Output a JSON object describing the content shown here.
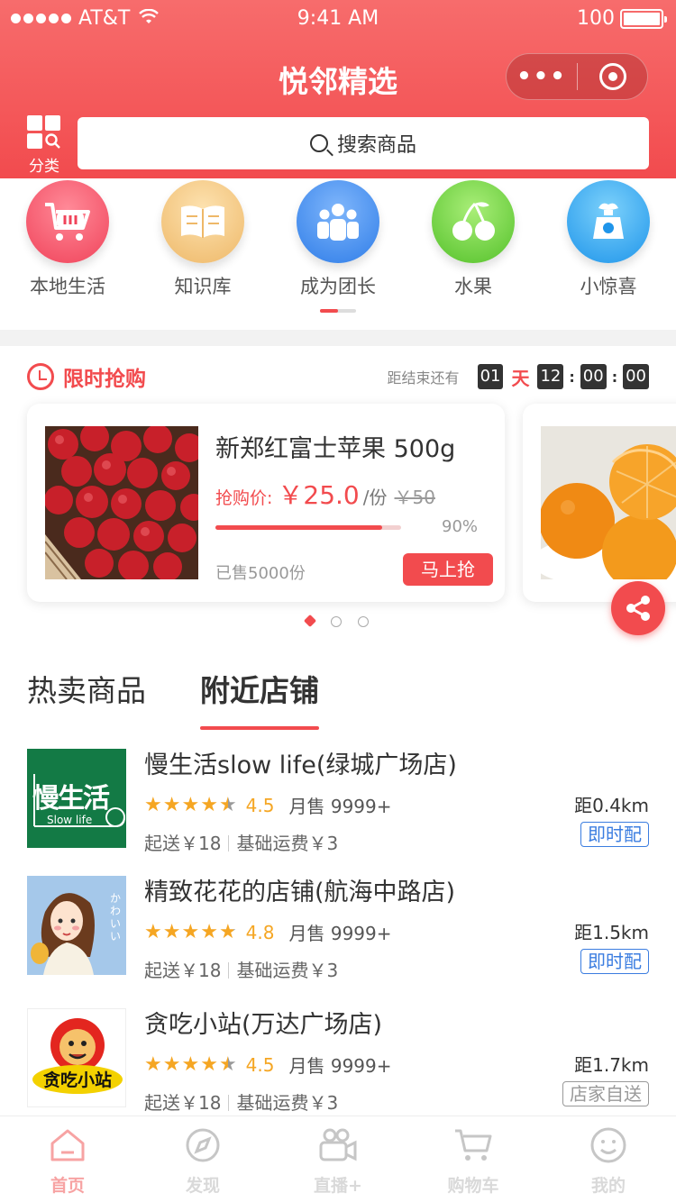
{
  "status_bar": {
    "carrier": "AT&T",
    "time": "9:41 AM",
    "battery": "100"
  },
  "header": {
    "title": "悦邻精选",
    "category_label": "分类",
    "search_placeholder": "搜索商品"
  },
  "categories": [
    {
      "label": "本地生活",
      "icon": "basket-icon",
      "color": "#f2576b"
    },
    {
      "label": "知识库",
      "icon": "book-icon",
      "color": "#f0c478"
    },
    {
      "label": "成为团长",
      "icon": "group-icon",
      "color": "#3f8ef0"
    },
    {
      "label": "水果",
      "icon": "cherry-icon",
      "color": "#6fd33e"
    },
    {
      "label": "小惊喜",
      "icon": "gift-bag-icon",
      "color": "#34a5ef"
    }
  ],
  "flash_sale": {
    "title": "限时抢购",
    "ends_in_label": "距结束还有",
    "days": "01",
    "day_unit": "天",
    "hours": "12",
    "minutes": "00",
    "seconds": "00",
    "product": {
      "name": "新郑红富士苹果 500g",
      "price_label": "抢购价:",
      "price": "￥25.0",
      "unit": "/份",
      "original_price": "￥50",
      "progress": 0.9,
      "progress_text": "90%",
      "sold": "已售5000份",
      "buy_label": "马上抢"
    }
  },
  "tabs": [
    {
      "label": "热卖商品"
    },
    {
      "label": "附近店铺"
    }
  ],
  "stores": [
    {
      "name": "慢生活slow life(绿城广场店)",
      "rating": "4.5",
      "rating_value": 4.5,
      "sales": "月售 9999+",
      "min_order": "起送￥18",
      "base_fee": "基础运费￥3",
      "distance": "距0.4km",
      "delivery": "即时配",
      "logo_text": "慢生活",
      "logo_sub": "Slow life"
    },
    {
      "name": "精致花花的店铺(航海中路店)",
      "rating": "4.8",
      "rating_value": 4.8,
      "sales": "月售 9999+",
      "min_order": "起送￥18",
      "base_fee": "基础运费￥3",
      "distance": "距1.5km",
      "delivery": "即时配",
      "logo_text": "かわいい"
    },
    {
      "name": "贪吃小站(万达广场店)",
      "rating": "4.5",
      "rating_value": 4.5,
      "sales": "月售 9999+",
      "min_order": "起送￥18",
      "base_fee": "基础运费￥3",
      "distance": "距1.7km",
      "delivery": "店家自送",
      "logo_text": "贪吃小站"
    }
  ],
  "tab_bar": [
    {
      "label": "首页",
      "icon": "home-icon"
    },
    {
      "label": "发现",
      "icon": "discover-icon"
    },
    {
      "label": "直播+",
      "icon": "camera-icon"
    },
    {
      "label": "购物车",
      "icon": "cart-icon"
    },
    {
      "label": "我的",
      "icon": "profile-icon"
    }
  ],
  "colors": {
    "accent": "#f24b4e",
    "star": "#f5a623",
    "tag_blue": "#3b7de0"
  }
}
